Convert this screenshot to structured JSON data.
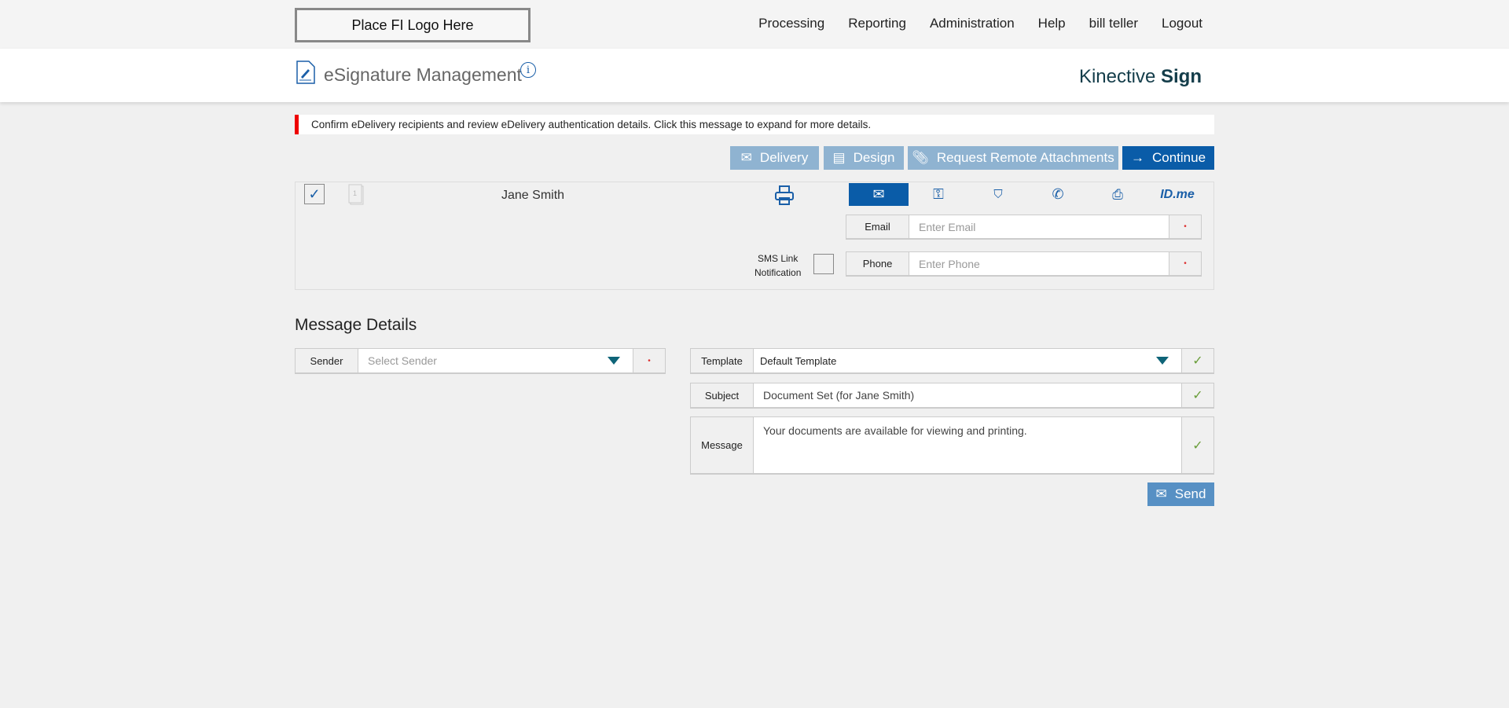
{
  "header": {
    "logo_text": "Place FI Logo Here",
    "nav": [
      "Processing",
      "Reporting",
      "Administration",
      "Help",
      "bill teller",
      "Logout"
    ]
  },
  "titlebar": {
    "title": "eSignature Management",
    "brand_light": "Kinective",
    "brand_bold": "Sign"
  },
  "alert": {
    "text": "Confirm eDelivery recipients and review eDelivery authentication details. Click this message to expand for more details.",
    "color": "#e00000"
  },
  "toolbar": {
    "delivery": "Delivery",
    "design": "Design",
    "attachments": "Request Remote Attachments",
    "continue": "Continue"
  },
  "recipient": {
    "name": "Jane Smith",
    "checked": true,
    "doc_count": "1",
    "auth_tabs": [
      "email-cloud",
      "key-cloud",
      "question-shield-cloud",
      "phone-cloud",
      "id-card-cloud",
      "ID.me"
    ],
    "active_tab": 0,
    "email_label": "Email",
    "email_placeholder": "Enter Email",
    "phone_label": "Phone",
    "phone_placeholder": "Enter Phone",
    "sms_label_1": "SMS Link",
    "sms_label_2": "Notification",
    "sms_checked": false,
    "required_mark": "•"
  },
  "message": {
    "heading": "Message Details",
    "sender_label": "Sender",
    "sender_placeholder": "Select Sender",
    "template_label": "Template",
    "template_value": "Default Template",
    "subject_label": "Subject",
    "subject_value": "Document Set (for Jane Smith)",
    "message_label": "Message",
    "message_value": "Your documents are available for viewing and printing.",
    "check": "✓",
    "send": "Send"
  },
  "colors": {
    "primary": "#0a5ca8",
    "disabled_button": "#8fb3d1",
    "send": "#5790c4",
    "valid": "#6a9e3a"
  }
}
